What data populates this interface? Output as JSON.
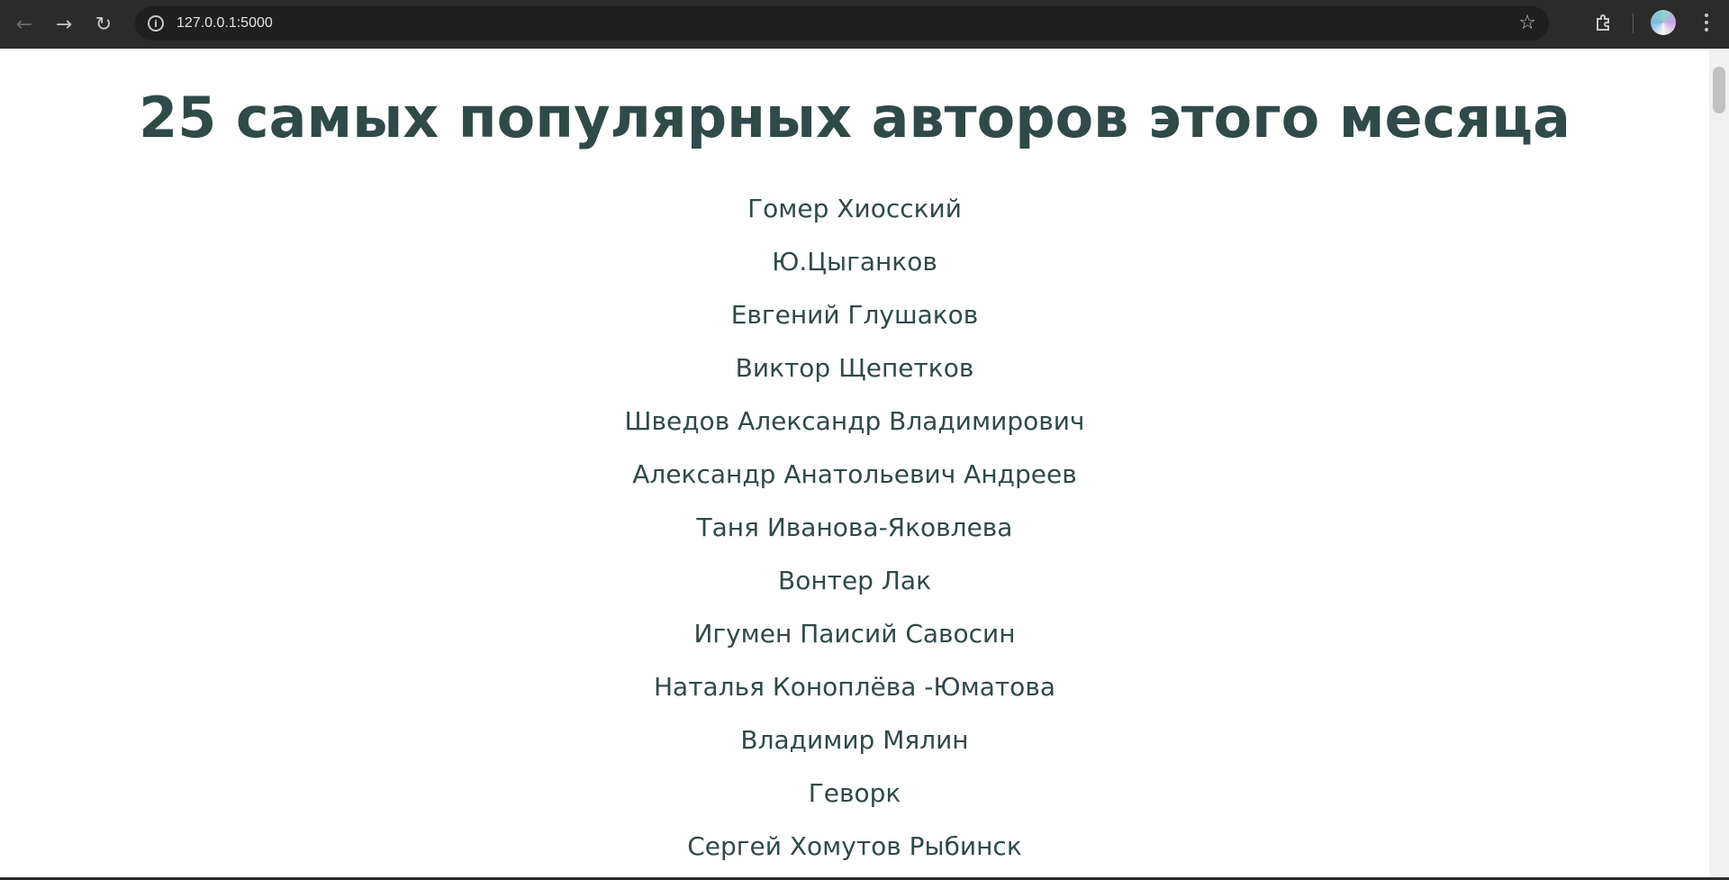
{
  "browser": {
    "url": "127.0.0.1:5000",
    "back_icon": "arrow-left-icon",
    "forward_icon": "arrow-right-icon",
    "reload_icon": "reload-icon",
    "site_info_icon": "info-icon",
    "bookmark_icon": "star-icon",
    "extensions_icon": "puzzle-icon",
    "menu_icon": "kebab-menu-icon"
  },
  "page": {
    "title": "25 самых популярных авторов этого месяца",
    "authors": [
      "Гомер Хиосский",
      "Ю.Цыганков",
      "Евгений Глушаков",
      "Виктор Щепетков",
      "Шведов Александр Владимирович",
      "Александр Анатольевич Андреев",
      "Таня Иванова-Яковлева",
      "Вонтер Лак",
      "Игумен Паисий Савосин",
      "Наталья Коноплёва -Юматова",
      "Владимир Мялин",
      "Геворк",
      "Сергей Хомутов Рыбинск"
    ]
  },
  "colors": {
    "text": "#2f4a49",
    "background": "#ffffff",
    "browser_chrome": "#2b2b2b"
  }
}
